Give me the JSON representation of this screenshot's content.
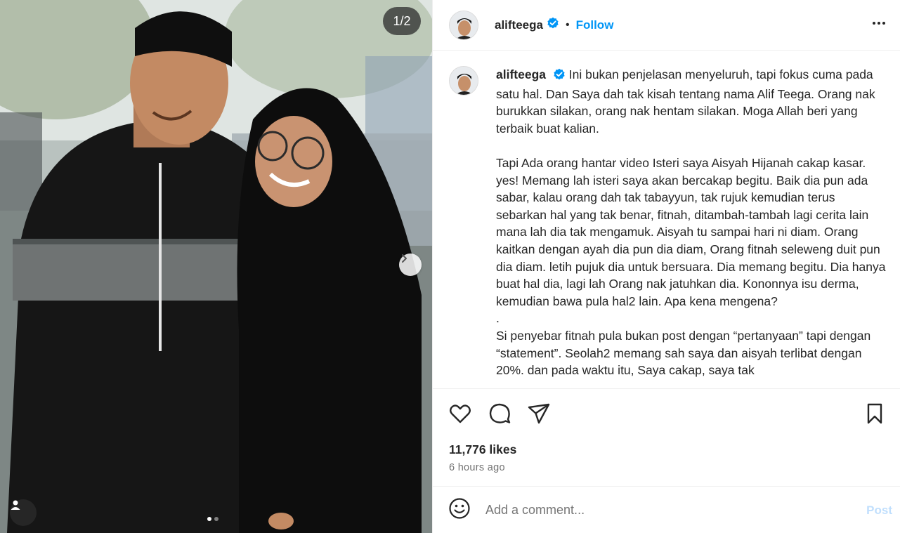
{
  "media": {
    "counter": "1/2",
    "dots": [
      true,
      false
    ],
    "icons": {
      "next": "chevron-right-icon",
      "tag": "user-tag-icon"
    }
  },
  "post": {
    "username": "alifteega",
    "verified": true,
    "separator": "•",
    "follow_label": "Follow",
    "more_icon": "more-horizontal-icon"
  },
  "caption": {
    "username": "alifteega",
    "paragraphs": [
      "Ini bukan penjelasan menyeluruh, tapi fokus cuma pada satu hal. Dan Saya dah tak kisah tentang nama Alif Teega. Orang nak burukkan silakan, orang nak hentam silakan. Moga Allah beri yang terbaik buat kalian.",
      "Tapi Ada orang hantar video Isteri saya Aisyah Hijanah cakap kasar. yes! Memang lah isteri saya akan bercakap begitu. Baik dia pun ada sabar, kalau orang dah tak tabayyun, tak rujuk kemudian terus sebarkan hal yang tak benar, fitnah, ditambah-tambah lagi cerita lain mana lah dia tak mengamuk. Aisyah tu sampai hari ni diam. Orang kaitkan dengan ayah dia pun dia diam, Orang fitnah seleweng duit pun dia diam. letih pujuk dia untuk bersuara. Dia memang begitu. Dia hanya buat hal dia, lagi lah Orang nak jatuhkan dia. Kononnya isu derma, kemudian bawa pula hal2 lain. Apa kena mengena?",
      ".",
      "Si penyebar fitnah pula bukan post dengan “pertanyaan” tapi dengan “statement”. Seolah2 memang sah saya dan aisyah terlibat dengan 20%. dan pada waktu itu, Saya cakap, saya tak"
    ]
  },
  "actions": {
    "icons": [
      "heart-icon",
      "comment-icon",
      "share-icon",
      "bookmark-icon"
    ],
    "likes": "11,776 likes",
    "timestamp": "6 hours ago"
  },
  "comment": {
    "emoji_icon": "emoji-icon",
    "placeholder": "Add a comment...",
    "post_label": "Post"
  },
  "colors": {
    "accent": "#0095f6",
    "verified": "#0095f6",
    "post_disabled": "#c0dffd",
    "text": "#262626",
    "muted": "#737373"
  }
}
